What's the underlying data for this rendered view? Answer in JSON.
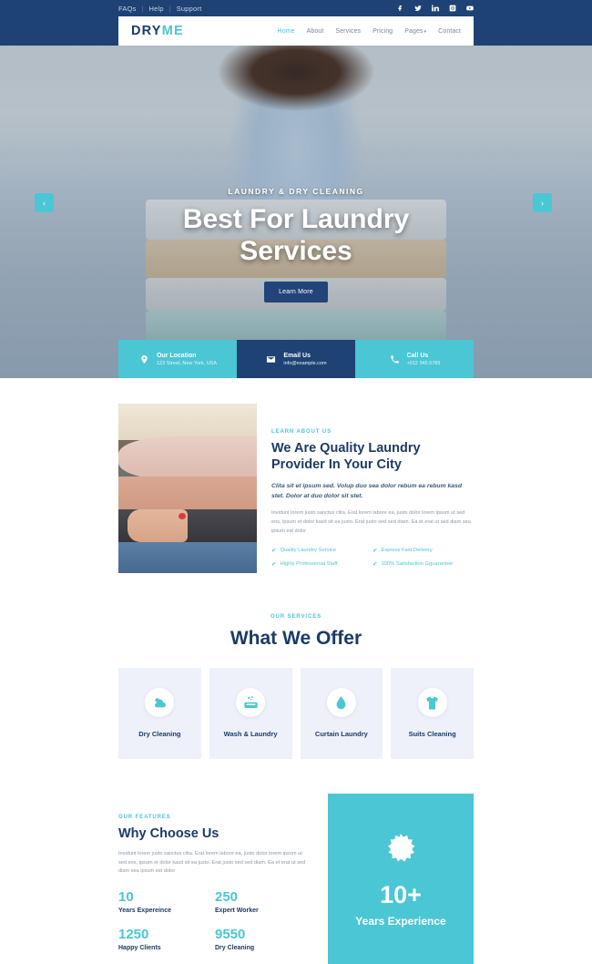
{
  "topbar": {
    "links": [
      {
        "label": "FAQs"
      },
      {
        "label": "Help"
      },
      {
        "label": "Support"
      }
    ],
    "separator": "|",
    "social": [
      {
        "name": "facebook-icon"
      },
      {
        "name": "twitter-icon"
      },
      {
        "name": "linkedin-icon"
      },
      {
        "name": "instagram-icon"
      },
      {
        "name": "youtube-icon"
      }
    ]
  },
  "nav": {
    "logo_primary": "DRY",
    "logo_accent": "ME",
    "items": [
      {
        "label": "Home",
        "active": true
      },
      {
        "label": "About",
        "active": false
      },
      {
        "label": "Services",
        "active": false
      },
      {
        "label": "Pricing",
        "active": false
      },
      {
        "label": "Pages",
        "active": false,
        "caret": "▾"
      },
      {
        "label": "Contact",
        "active": false
      }
    ]
  },
  "hero": {
    "kicker": "LAUNDRY & DRY CLEANING",
    "title": "Best For Laundry Services",
    "button": "Learn More",
    "prev_arrow": "‹",
    "next_arrow": "›"
  },
  "contactbar": [
    {
      "icon": "location-pin-icon",
      "title": "Our Location",
      "sub": "123 Street, New York, USA"
    },
    {
      "icon": "envelope-icon",
      "title": "Email Us",
      "sub": "info@example.com"
    },
    {
      "icon": "phone-icon",
      "title": "Call Us",
      "sub": "+012 345 6789"
    }
  ],
  "about": {
    "kicker": "LEARN ABOUT US",
    "title": "We Are Quality Laundry Provider In Your City",
    "lead": "Clita sit et ipsum sed. Volup duo sea dolor rebum ea rebum kasd stet. Dolor at duo dolor sit stet.",
    "paragraph": "Invidunt lorem justo sanctus clita. Erat lorem labore ea, justo dolor lorem ipsum ut sed eos, ipsum et dolor kasd sit ea justo. Erat justo sed sed diam. Ea et erat ut sed diam sea ipsum est dolor",
    "check_mark": "✔",
    "checks": [
      "Quality Laundry Service",
      "Express Fast Delivery",
      "Highly Professional Staff",
      "100% Satisfaction Gguarantee"
    ]
  },
  "services": {
    "kicker": "OUR SERVICES",
    "title": "What We Offer",
    "cards": [
      {
        "icon": "sun-cloud-icon",
        "label": "Dry Cleaning"
      },
      {
        "icon": "soap-bar-icon",
        "label": "Wash & Laundry"
      },
      {
        "icon": "water-drop-icon",
        "label": "Curtain Laundry"
      },
      {
        "icon": "tshirt-icon",
        "label": "Suits Cleaning"
      }
    ]
  },
  "features": {
    "kicker": "OUR FEATURES",
    "title": "Why Choose Us",
    "paragraph": "Invidunt lorem justo sanctus clita. Erat lorem labore ea, justo dolor lorem ipsum ut sed eos, ipsum et dolor kasd sit ea justo. Erat justo sed sed diam. Ea et erat ut sed diam sea ipsum est dolor",
    "stats": [
      {
        "number": "10",
        "label": "Years Expereince"
      },
      {
        "number": "250",
        "label": "Expert Worker"
      },
      {
        "number": "1250",
        "label": "Happy Clients"
      },
      {
        "number": "9550",
        "label": "Dry Cleaning"
      }
    ],
    "badge": {
      "icon": "starburst-icon",
      "number": "10+",
      "label": "Years Experience"
    }
  },
  "colors": {
    "navy": "#1e4273",
    "teal": "#4bc6d4",
    "heading": "#1b3b66",
    "card_bg": "#eef1fa"
  }
}
